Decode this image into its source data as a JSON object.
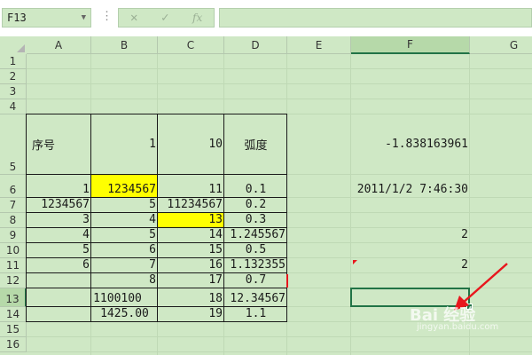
{
  "formula_bar": {
    "name_box": "F13",
    "separator": "⋮",
    "cancel_icon": "✕",
    "enter_icon": "✓",
    "function_icon": "fx",
    "formula": ""
  },
  "columns": [
    "A",
    "B",
    "C",
    "D",
    "E",
    "F",
    "G"
  ],
  "rows": [
    "1",
    "2",
    "3",
    "4",
    "5",
    "6",
    "7",
    "8",
    "9",
    "10",
    "11",
    "12",
    "13",
    "14",
    "15",
    "16"
  ],
  "selected_cell": "F13",
  "cells": {
    "A5": "序号",
    "B5": "1",
    "C5": "10",
    "D5": "弧度",
    "F5": "-1.838163961",
    "A6": "1",
    "B6": "1234567",
    "C6": "11",
    "D6": "0.1",
    "F6": "2011/1/2 7:46:30",
    "A7": "1234567",
    "B7": "5",
    "C7": "11234567",
    "D7": "0.2",
    "A8": "3",
    "B8": "4",
    "C8": "13",
    "D8": "0.3",
    "A9": "4",
    "B9": "5",
    "C9": "14",
    "D9": "1.245567",
    "F9": "2",
    "A10": "5",
    "B10": "6",
    "C10": "15",
    "D10": "0.5",
    "A11": "6",
    "B11": "7",
    "C11": "16",
    "D11": "1.132355",
    "F11": "2",
    "B12": "8",
    "C12": "17",
    "D12": "0.7",
    "B13": "1100100",
    "C13": "18",
    "D13": "12.34567",
    "B14": "1425.00",
    "C14": "19",
    "D14": "1.1"
  },
  "highlight_color": "#ffff00",
  "highlighted_cells": [
    "B6",
    "C8"
  ],
  "annotation_arrow_color": "#e8161d",
  "watermark": {
    "brand": "Bai 经验",
    "url": "jingyan.baidu.com"
  }
}
